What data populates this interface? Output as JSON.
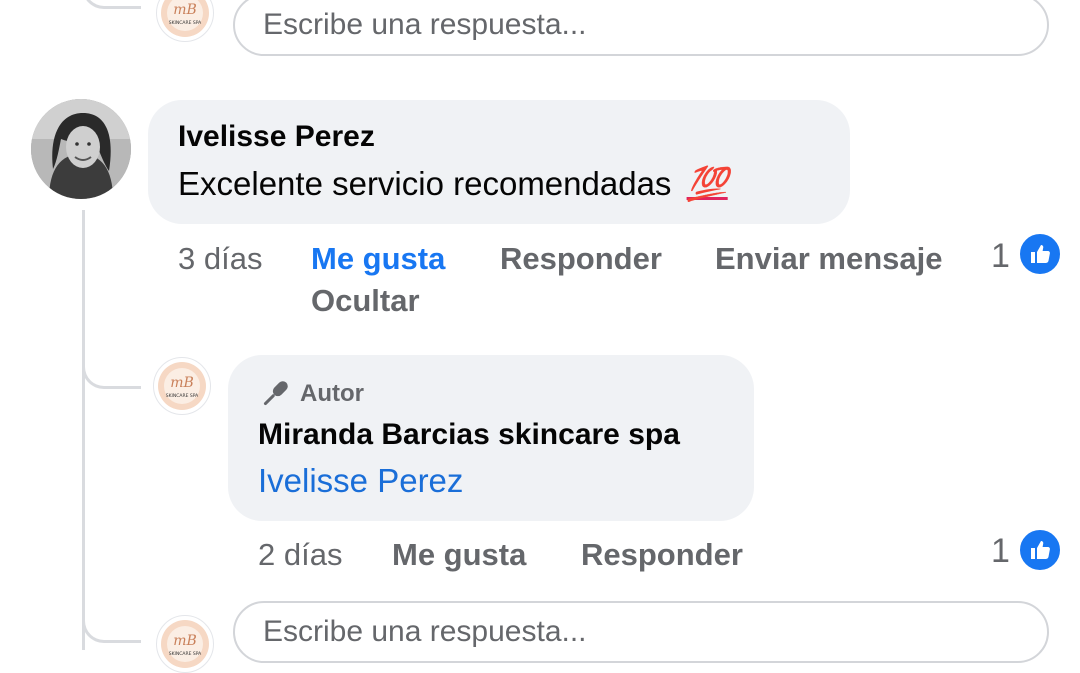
{
  "reply_box_top": {
    "placeholder": "Escribe una respuesta..."
  },
  "comment": {
    "author": "Ivelisse Perez",
    "text": "Excelente servicio recomendadas",
    "emoji": "💯",
    "time": "3 días",
    "actions": {
      "like": "Me gusta",
      "reply": "Responder",
      "message": "Enviar mensaje",
      "hide": "Ocultar"
    },
    "like_count": "1"
  },
  "reply": {
    "badge": "Autor",
    "author": "Miranda Barcias skincare spa",
    "mention": "Ivelisse Perez",
    "time": "2 días",
    "actions": {
      "like": "Me gusta",
      "reply": "Responder"
    },
    "like_count": "1"
  },
  "reply_box_bottom": {
    "placeholder": "Escribe una respuesta..."
  },
  "page_avatar": {
    "monogram": "mB",
    "caption": "SKINCARE SPA"
  },
  "colors": {
    "accent": "#1877f2",
    "bubble": "#f0f2f5",
    "muted": "#65676b"
  }
}
